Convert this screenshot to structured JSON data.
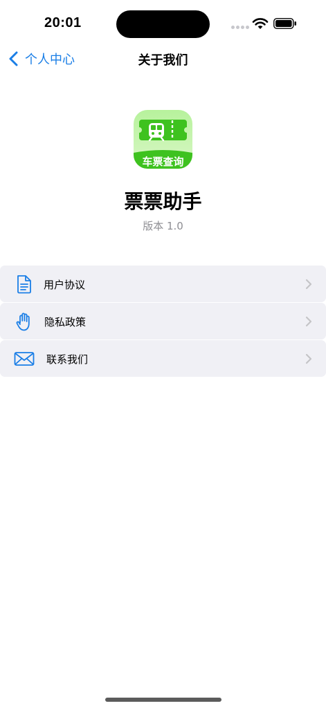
{
  "status_bar": {
    "time": "20:01"
  },
  "nav": {
    "back_label": "个人中心",
    "title": "关于我们"
  },
  "app": {
    "name": "票票助手",
    "version": "版本 1.0",
    "icon_banner": "车票查询"
  },
  "menu": {
    "items": [
      {
        "label": "用户协议",
        "icon": "document-icon"
      },
      {
        "label": "隐私政策",
        "icon": "hand-icon"
      },
      {
        "label": "联系我们",
        "icon": "mail-icon"
      }
    ]
  },
  "colors": {
    "accent": "#1a7ee6",
    "icon_green": "#3ec21f",
    "row_background": "#f0f0f5",
    "chevron": "#c4c4c7"
  }
}
